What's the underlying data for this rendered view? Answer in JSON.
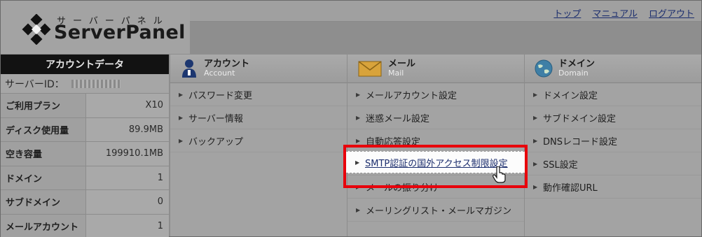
{
  "header": {
    "logo_kana": "サーバーパネル",
    "logo_text": "ServerPanel",
    "links": [
      "トップ",
      "マニュアル",
      "ログアウト"
    ]
  },
  "account_panel": {
    "title": "アカウントデータ",
    "server_id_label": "サーバーID：",
    "rows": [
      {
        "label": "ご利用プラン",
        "value": "X10"
      },
      {
        "label": "ディスク使用量",
        "value": "89.9MB"
      },
      {
        "label": "空き容量",
        "value": "199910.1MB"
      },
      {
        "label": "ドメイン",
        "value": "1"
      },
      {
        "label": "サブドメイン",
        "value": "0"
      },
      {
        "label": "メールアカウント",
        "value": "1"
      }
    ]
  },
  "columns": [
    {
      "title": "アカウント",
      "subtitle": "Account",
      "icon": "user-icon",
      "items": [
        "パスワード変更",
        "サーバー情報",
        "バックアップ"
      ]
    },
    {
      "title": "メール",
      "subtitle": "Mail",
      "icon": "mail-icon",
      "items": [
        "メールアカウント設定",
        "迷惑メール設定",
        "自動応答設定",
        "SMTP認証の国外アクセス制限設定",
        "メールの振り分け",
        "メーリングリスト・メールマガジン"
      ]
    },
    {
      "title": "ドメイン",
      "subtitle": "Domain",
      "icon": "globe-icon",
      "items": [
        "ドメイン設定",
        "サブドメイン設定",
        "DNSレコード設定",
        "SSL設定",
        "動作確認URL"
      ]
    }
  ],
  "highlight_color": "#e8000b"
}
